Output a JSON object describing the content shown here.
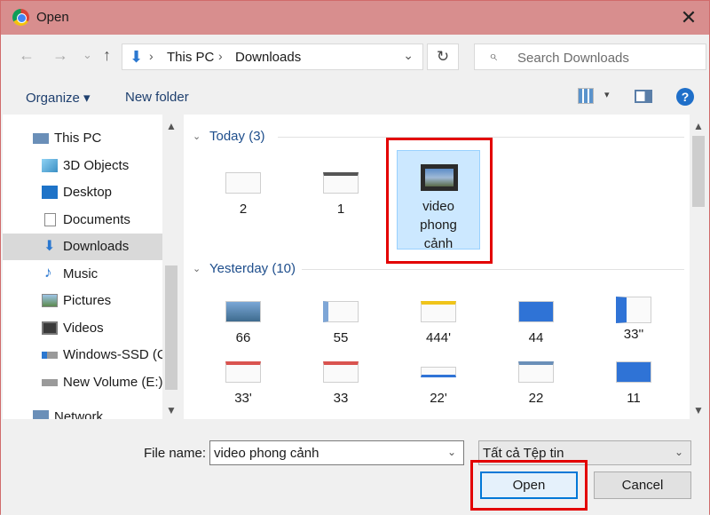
{
  "window": {
    "title": "Open",
    "app_icon": "chrome-icon",
    "close_glyph": "✕"
  },
  "nav": {
    "back": "←",
    "forward": "→",
    "recent": "⌄",
    "up": "↑",
    "breadcrumb": [
      "This PC",
      "Downloads"
    ],
    "search_placeholder": "Search Downloads"
  },
  "toolbar": {
    "organize": "Organize ▾",
    "new_folder": "New folder",
    "help": "?"
  },
  "sidebar": {
    "items": [
      {
        "label": "This PC",
        "icon": "pc-icon"
      },
      {
        "label": "3D Objects",
        "icon": "3d-objects-icon"
      },
      {
        "label": "Desktop",
        "icon": "desktop-icon"
      },
      {
        "label": "Documents",
        "icon": "documents-icon"
      },
      {
        "label": "Downloads",
        "icon": "downloads-icon",
        "selected": true
      },
      {
        "label": "Music",
        "icon": "music-icon"
      },
      {
        "label": "Pictures",
        "icon": "pictures-icon"
      },
      {
        "label": "Videos",
        "icon": "videos-icon"
      },
      {
        "label": "Windows-SSD (C",
        "icon": "drive-icon"
      },
      {
        "label": "New Volume (E:)",
        "icon": "drive-icon"
      },
      {
        "label": "Network",
        "icon": "network-icon"
      }
    ]
  },
  "groups": {
    "today": {
      "label": "Today (3)",
      "files": [
        "2",
        "1"
      ],
      "selected_file": "video phong cảnh"
    },
    "yesterday": {
      "label": "Yesterday (10)",
      "files": [
        "66",
        "55",
        "444'",
        "44",
        "33''",
        "33'",
        "33",
        "22'",
        "22",
        "11"
      ]
    }
  },
  "bottom": {
    "file_name_label": "File name:",
    "file_name_value": "video phong cảnh",
    "filter": "Tất cả Tệp tin",
    "open": "Open",
    "cancel": "Cancel"
  },
  "colors": {
    "highlight": "#e30000",
    "accent": "#0078d7",
    "title_bar": "#d88e8e"
  }
}
